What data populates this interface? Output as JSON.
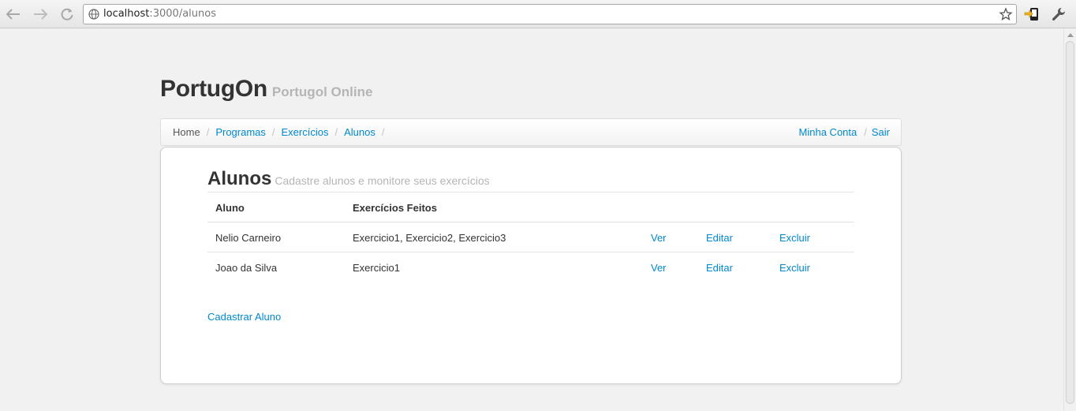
{
  "browser": {
    "url_host": "localhost",
    "url_path": ":3000/alunos"
  },
  "brand": {
    "title": "PortugOn",
    "subtitle": "Portugol Online"
  },
  "breadcrumb": {
    "items": [
      "Home",
      "Programas",
      "Exercícios",
      "Alunos"
    ],
    "separator": "/",
    "right": [
      "Minha Conta",
      "Sair"
    ]
  },
  "page": {
    "title": "Alunos",
    "subtitle": "Cadastre alunos e monitore seus exercícios"
  },
  "table": {
    "headers": [
      "Aluno",
      "Exercícios Feitos"
    ],
    "rows": [
      {
        "aluno": "Nelio Carneiro",
        "exercicios": "Exercicio1, Exercicio2, Exercicio3",
        "ver": "Ver",
        "editar": "Editar",
        "excluir": "Excluir"
      },
      {
        "aluno": "Joao da Silva",
        "exercicios": "Exercicio1",
        "ver": "Ver",
        "editar": "Editar",
        "excluir": "Excluir"
      }
    ]
  },
  "actions": {
    "new_student": "Cadastrar Aluno"
  },
  "colors": {
    "link": "#0088cc",
    "text": "#333333",
    "muted": "#b5b5b5"
  }
}
